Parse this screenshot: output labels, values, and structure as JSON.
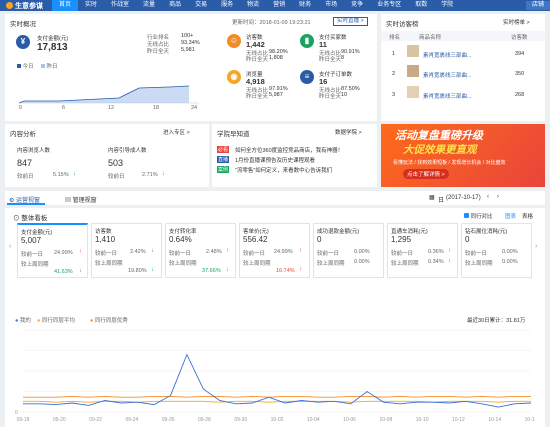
{
  "nav": {
    "brand": "生意参谋",
    "items": [
      "首页",
      "实时",
      "作战室",
      "流量",
      "商品",
      "交易",
      "服务",
      "物流",
      "营销",
      "财务",
      "市场",
      "竞争",
      "业务专区",
      "取数",
      "学院"
    ],
    "right": "店铺"
  },
  "realtime": {
    "title": "实时概况",
    "update": "更新时间：2018-01-09 19:23:21",
    "link": "实时直播 >",
    "pay": {
      "label": "支付金额(元)",
      "value": "17,813",
      "rank_label": "行业排名",
      "rank": "100+",
      "yesterday_label": "无线占比",
      "yesterday": "93.34%",
      "all_label": "昨日全天",
      "all": "5,981"
    },
    "legend": [
      "今日",
      "昨日"
    ],
    "xticks": [
      "0",
      "6",
      "12",
      "18",
      "24"
    ],
    "metrics": [
      {
        "label": "访客数",
        "value": "1,442",
        "l1": "无线占比",
        "v1": "98.20%",
        "l2": "昨日全天",
        "v2": "1,808",
        "color": "#f28c28",
        "icon": "person-icon"
      },
      {
        "label": "支付买家数",
        "value": "11",
        "l1": "无线占比",
        "v1": "90.91%",
        "l2": "昨日全天",
        "v2": "8",
        "color": "#1aa260",
        "icon": "buyer-icon"
      },
      {
        "label": "浏览量",
        "value": "4,918",
        "l1": "无线占比",
        "v1": "97.91%",
        "l2": "昨日全天",
        "v2": "5,987",
        "color": "#f5a623",
        "icon": "eye-icon"
      },
      {
        "label": "支付子订单数",
        "value": "16",
        "l1": "无线占比",
        "v1": "87.50%",
        "l2": "昨日全天",
        "v2": "10",
        "color": "#2a5ca8",
        "icon": "order-icon"
      }
    ]
  },
  "rank": {
    "title": "实时访客榜",
    "link": "实时榜单 >",
    "headers": [
      "排名",
      "商品名称",
      "访客数"
    ],
    "rows": [
      {
        "rank": "1",
        "name": "素肖宽裹线三部曲...",
        "count": "394"
      },
      {
        "rank": "2",
        "name": "素肖宽裹线三部曲...",
        "count": "350"
      },
      {
        "rank": "3",
        "name": "素肖宽裹线三部曲...",
        "count": "268"
      }
    ]
  },
  "content": {
    "title": "内容分析",
    "link": "进入专区 >",
    "left": {
      "label": "内容浏览人数",
      "value": "847",
      "change_label": "较前日",
      "change": "5.15%"
    },
    "right": {
      "label": "内容引导成人数",
      "value": "503",
      "change_label": "较前日",
      "change": "2.71%"
    }
  },
  "school": {
    "title": "学院早知道",
    "link": "数据学院 >",
    "items": [
      {
        "tag": "必看",
        "text": "如何全方位360度监控竞品商店，我有神器！"
      },
      {
        "tag": "直播",
        "text": "1月份直播课预告及历史课程观看"
      },
      {
        "tag": "案例",
        "text": "“流零售”如何定义，来看数中心告诉我们"
      }
    ]
  },
  "banner": {
    "line1": "活动复盘重磅升级",
    "line2": "大促效果更直观",
    "line3": "看懂玩法 / 找到效果短板 / 发现增长机会 / 对比盘效",
    "btn": "点击了解详情 >"
  },
  "tabs": [
    "运营视窗",
    "管理视窗"
  ],
  "date": {
    "label": "日",
    "value": "(2017-10-17)"
  },
  "overview": {
    "title": "整体看板",
    "compare": "同行对比",
    "views": [
      "图表",
      "表格"
    ],
    "cards": [
      {
        "label": "支付金额(元)",
        "value": "5,007",
        "c1l": "较前一日",
        "c1": "24.99%",
        "c2l": "较上周同期",
        "c2": "41.63%"
      },
      {
        "label": "访客数",
        "value": "1,410",
        "c1l": "较前一日",
        "c1": "2.42%",
        "c2l": "较上周同期",
        "c2": "19.80%"
      },
      {
        "label": "支付转化率",
        "value": "0.64%",
        "c1l": "较前一日",
        "c1": "2.48%",
        "c2l": "较上周同期",
        "c2": "37.66%"
      },
      {
        "label": "客单价(元)",
        "value": "556.42",
        "c1l": "较前一日",
        "c1": "24.99%",
        "c2l": "较上周同期",
        "c2": "16.74%"
      },
      {
        "label": "成功退款金额(元)",
        "value": "0",
        "c1l": "较前一日",
        "c1": "0.00%",
        "c2l": "较上周同期",
        "c2": "0.00%"
      },
      {
        "label": "直通车消耗(元)",
        "value": "1,295",
        "c1l": "较前一日",
        "c1": "0.36%",
        "c2l": "较上周同期",
        "c2": "0.34%"
      },
      {
        "label": "钻石展位消耗(元)",
        "value": "0",
        "c1l": "较前一日",
        "c1": "0.00%",
        "c2l": "较上周同期",
        "c2": "0.00%"
      }
    ]
  },
  "chart_data": {
    "type": "line",
    "legend": [
      "我的",
      "同行同层平均",
      "同行同层优秀"
    ],
    "summary": "最近30日累计：31.81万",
    "x": [
      "09-18",
      "09-20",
      "09-22",
      "09-24",
      "09-26",
      "09-28",
      "09-30",
      "10-02",
      "10-04",
      "10-06",
      "10-08",
      "10-10",
      "10-12",
      "10-14",
      "10-17"
    ],
    "ylim": [
      0,
      100
    ],
    "ytick_labels": [
      "0",
      "",
      "",
      "",
      ""
    ],
    "series": [
      {
        "name": "我的",
        "color": "#3a6fd8",
        "values": [
          10,
          10,
          9,
          11,
          8,
          14,
          11,
          12,
          9,
          20,
          70,
          28,
          14,
          10,
          11,
          18,
          11,
          14,
          12,
          13,
          10,
          25,
          12,
          10,
          12,
          12,
          11,
          13,
          10,
          6,
          10,
          11
        ]
      },
      {
        "name": "同行同层平均",
        "color": "#f5a623",
        "values": [
          13,
          13,
          12,
          13,
          12,
          13,
          13,
          12,
          13,
          13,
          13,
          13,
          12,
          13,
          13,
          12,
          13,
          13,
          13,
          13,
          12,
          13,
          13,
          13,
          13,
          12,
          13,
          13,
          13,
          12,
          13,
          13
        ]
      },
      {
        "name": "同行同层优秀",
        "color": "#f28c28",
        "values": [
          18,
          18,
          18,
          19,
          18,
          19,
          18,
          18,
          19,
          19,
          18,
          19,
          19,
          18,
          19,
          18,
          19,
          19,
          18,
          18,
          19,
          19,
          18,
          19,
          18,
          19,
          19,
          18,
          19,
          18,
          19,
          19
        ]
      }
    ]
  }
}
